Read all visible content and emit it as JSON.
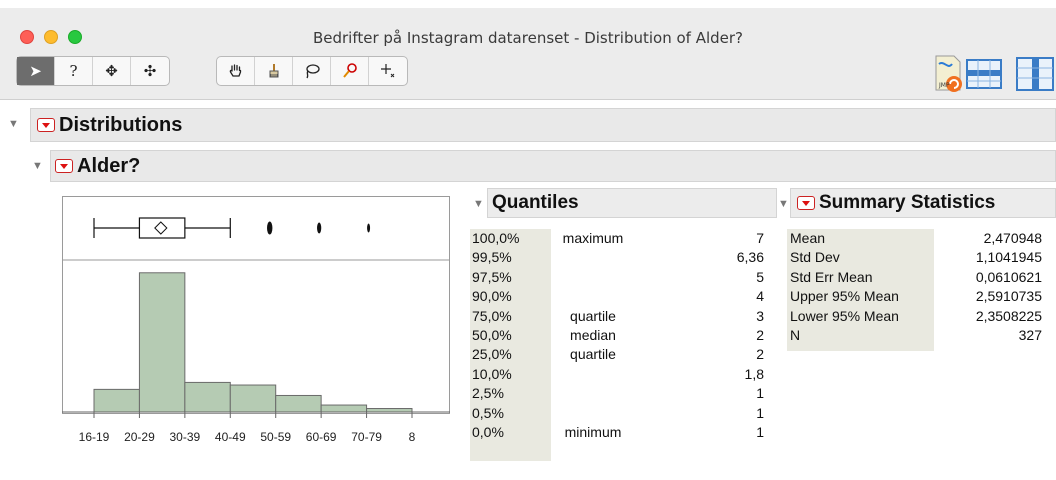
{
  "window": {
    "title": "Bedrifter på Instagram datarenset - Distribution of Alder?"
  },
  "toolbar": {
    "tools_left": [
      {
        "name": "arrow-tool",
        "glyph": "➤"
      },
      {
        "name": "help-tool",
        "glyph": "?"
      },
      {
        "name": "selection-tool",
        "glyph": "✥"
      },
      {
        "name": "scroller-tool",
        "glyph": "✣"
      }
    ],
    "tools_mid": [
      {
        "name": "grabber-tool",
        "glyph": "✋"
      },
      {
        "name": "brush-tool",
        "glyph": "🖌"
      },
      {
        "name": "lasso-tool",
        "glyph": "➰"
      },
      {
        "name": "magnifier-tool",
        "glyph": "🔍"
      },
      {
        "name": "crosshair-tool",
        "glyph": "+"
      }
    ]
  },
  "outline": {
    "distributions_label": "Distributions",
    "variable_label": "Alder?"
  },
  "quantiles": {
    "title": "Quantiles",
    "rows": [
      {
        "pct": "100,0%",
        "label": "maximum",
        "value": "7"
      },
      {
        "pct": "99,5%",
        "label": "",
        "value": "6,36"
      },
      {
        "pct": "97,5%",
        "label": "",
        "value": "5"
      },
      {
        "pct": "90,0%",
        "label": "",
        "value": "4"
      },
      {
        "pct": "75,0%",
        "label": "quartile",
        "value": "3"
      },
      {
        "pct": "50,0%",
        "label": "median",
        "value": "2"
      },
      {
        "pct": "25,0%",
        "label": "quartile",
        "value": "2"
      },
      {
        "pct": "10,0%",
        "label": "",
        "value": "1,8"
      },
      {
        "pct": "2,5%",
        "label": "",
        "value": "1"
      },
      {
        "pct": "0,5%",
        "label": "",
        "value": "1"
      },
      {
        "pct": "0,0%",
        "label": "minimum",
        "value": "1"
      }
    ]
  },
  "summary": {
    "title": "Summary Statistics",
    "rows": [
      {
        "label": "Mean",
        "value": "2,470948"
      },
      {
        "label": "Std Dev",
        "value": "1,1041945"
      },
      {
        "label": "Std Err Mean",
        "value": "0,0610621"
      },
      {
        "label": "Upper 95% Mean",
        "value": "2,5910735"
      },
      {
        "label": "Lower 95% Mean",
        "value": "2,3508225"
      },
      {
        "label": "N",
        "value": "327"
      }
    ]
  },
  "chart_data": {
    "type": "bar",
    "categories": [
      "16-19",
      "20-29",
      "30-39",
      "40-49",
      "50-59",
      "60-69",
      "70-79",
      "8"
    ],
    "bin_labels": [
      "16-19",
      "20-29",
      "30-39",
      "40-49",
      "50-59",
      "60-69",
      "70-79"
    ],
    "values": [
      26,
      160,
      34,
      31,
      19,
      8,
      4
    ],
    "bin_edges": [
      1,
      2,
      3,
      4,
      5,
      6,
      7,
      8
    ],
    "box": {
      "min": 1,
      "q1": 2,
      "median": 2,
      "q3": 3,
      "whisker_high": 4,
      "mean": 2.470948,
      "outliers": [
        5,
        6,
        7
      ]
    },
    "bar_color": "#b5cbb3"
  }
}
